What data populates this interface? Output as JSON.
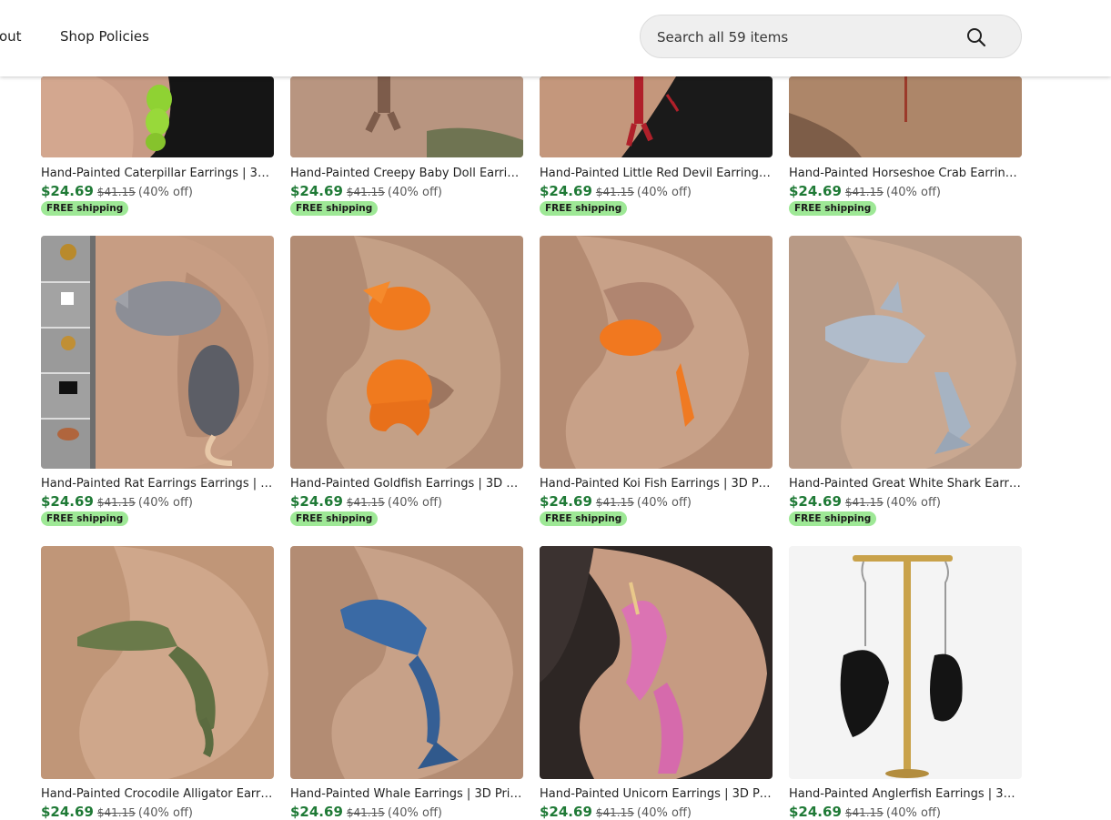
{
  "header": {
    "nav": [
      "out",
      "Shop Policies"
    ],
    "search_placeholder": "Search all 59 items"
  },
  "products": [
    {
      "title": "Hand-Painted Caterpillar Earrings | 3D ...",
      "price": "$24.69",
      "original": "$41.15",
      "discount": "(40% off)",
      "shipping": "FREE shipping",
      "image": "caterpillar-earring"
    },
    {
      "title": "Hand-Painted Creepy Baby Doll Earrin...",
      "price": "$24.69",
      "original": "$41.15",
      "discount": "(40% off)",
      "shipping": "FREE shipping",
      "image": "baby-doll-earring"
    },
    {
      "title": "Hand-Painted Little Red Devil Earrings ...",
      "price": "$24.69",
      "original": "$41.15",
      "discount": "(40% off)",
      "shipping": "FREE shipping",
      "image": "red-devil-earring"
    },
    {
      "title": "Hand-Painted Horseshoe Crab Earring...",
      "price": "$24.69",
      "original": "$41.15",
      "discount": "(40% off)",
      "shipping": "FREE shipping",
      "image": "horseshoe-crab-earring"
    },
    {
      "title": "Hand-Painted Rat Earrings Earrings | 3...",
      "price": "$24.69",
      "original": "$41.15",
      "discount": "(40% off)",
      "shipping": "FREE shipping",
      "image": "rat-earring"
    },
    {
      "title": "Hand-Painted Goldfish Earrings | 3D Pr...",
      "price": "$24.69",
      "original": "$41.15",
      "discount": "(40% off)",
      "shipping": "FREE shipping",
      "image": "goldfish-earring"
    },
    {
      "title": "Hand-Painted Koi Fish Earrings | 3D Pri...",
      "price": "$24.69",
      "original": "$41.15",
      "discount": "(40% off)",
      "shipping": "FREE shipping",
      "image": "koi-fish-earring"
    },
    {
      "title": "Hand-Painted Great White Shark Earrin...",
      "price": "$24.69",
      "original": "$41.15",
      "discount": "(40% off)",
      "shipping": "FREE shipping",
      "image": "shark-earring"
    },
    {
      "title": "Hand-Painted Crocodile Alligator Earri...",
      "price": "$24.69",
      "original": "$41.15",
      "discount": "(40% off)",
      "shipping": "",
      "image": "crocodile-earring"
    },
    {
      "title": "Hand-Painted Whale Earrings | 3D Print...",
      "price": "$24.69",
      "original": "$41.15",
      "discount": "(40% off)",
      "shipping": "",
      "image": "whale-earring"
    },
    {
      "title": "Hand-Painted Unicorn Earrings | 3D Pri...",
      "price": "$24.69",
      "original": "$41.15",
      "discount": "(40% off)",
      "shipping": "",
      "image": "unicorn-earring"
    },
    {
      "title": "Hand-Painted Anglerfish Earrings | 3D ...",
      "price": "$24.69",
      "original": "$41.15",
      "discount": "(40% off)",
      "shipping": "",
      "image": "anglerfish-earring"
    }
  ]
}
